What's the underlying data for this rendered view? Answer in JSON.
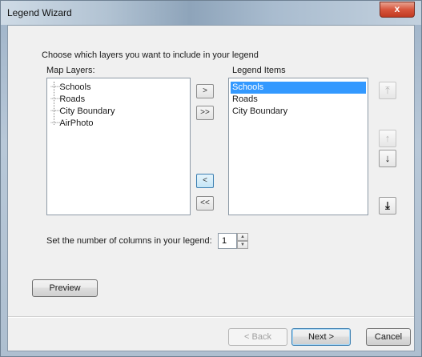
{
  "window": {
    "title": "Legend Wizard",
    "close_label": "x"
  },
  "prompt": "Choose which layers you want to include in your legend",
  "map_layers": {
    "label": "Map Layers:",
    "items": [
      "Schools",
      "Roads",
      "City Boundary",
      "AirPhoto"
    ]
  },
  "legend_items": {
    "label": "Legend Items",
    "items": [
      "Schools",
      "Roads",
      "City Boundary"
    ],
    "selected": "Schools"
  },
  "transfer_buttons": {
    "add_one": ">",
    "add_all": ">>",
    "remove_one": "<",
    "remove_all": "<<"
  },
  "order_buttons": {
    "move_top": "⤒",
    "move_up": "↑",
    "move_down": "↓",
    "move_bottom": "⤓"
  },
  "columns": {
    "label": "Set the number of columns in your legend:",
    "value": "1"
  },
  "buttons": {
    "preview": "Preview",
    "back": "< Back",
    "next": "Next >",
    "cancel": "Cancel"
  },
  "colors": {
    "selection": "#3399ff",
    "close_button": "#c13a22"
  }
}
